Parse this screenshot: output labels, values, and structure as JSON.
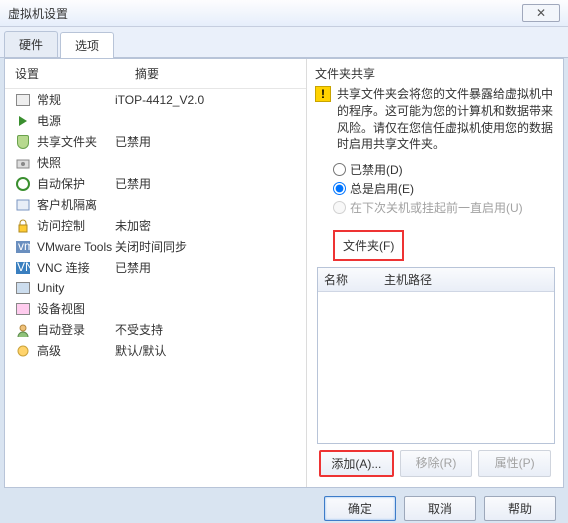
{
  "window": {
    "title": "虚拟机设置",
    "close": "✕"
  },
  "tabs": {
    "hardware": "硬件",
    "options": "选项"
  },
  "left": {
    "head_setting": "设置",
    "head_summary": "摘要",
    "items": [
      {
        "label": "常规",
        "summary": "iTOP-4412_V2.0"
      },
      {
        "label": "电源",
        "summary": ""
      },
      {
        "label": "共享文件夹",
        "summary": "已禁用"
      },
      {
        "label": "快照",
        "summary": ""
      },
      {
        "label": "自动保护",
        "summary": "已禁用"
      },
      {
        "label": "客户机隔离",
        "summary": ""
      },
      {
        "label": "访问控制",
        "summary": "未加密"
      },
      {
        "label": "VMware Tools",
        "summary": "关闭时间同步"
      },
      {
        "label": "VNC 连接",
        "summary": "已禁用"
      },
      {
        "label": "Unity",
        "summary": ""
      },
      {
        "label": "设备视图",
        "summary": ""
      },
      {
        "label": "自动登录",
        "summary": "不受支持"
      },
      {
        "label": "高级",
        "summary": "默认/默认"
      }
    ]
  },
  "right": {
    "section": "文件夹共享",
    "warning_text": "共享文件夹会将您的文件暴露给虚拟机中的程序。这可能为您的计算机和数据带来风险。请仅在您信任虚拟机使用您的数据时启用共享文件夹。",
    "radios": {
      "disabled": "已禁用(D)",
      "always": "总是启用(E)",
      "until": "在下次关机或挂起前一直启用(U)"
    },
    "folders_label": "文件夹(F)",
    "folders_head_name": "名称",
    "folders_head_path": "主机路径",
    "btn_add": "添加(A)...",
    "btn_remove": "移除(R)",
    "btn_props": "属性(P)"
  },
  "dialog": {
    "ok": "确定",
    "cancel": "取消",
    "help": "帮助"
  }
}
